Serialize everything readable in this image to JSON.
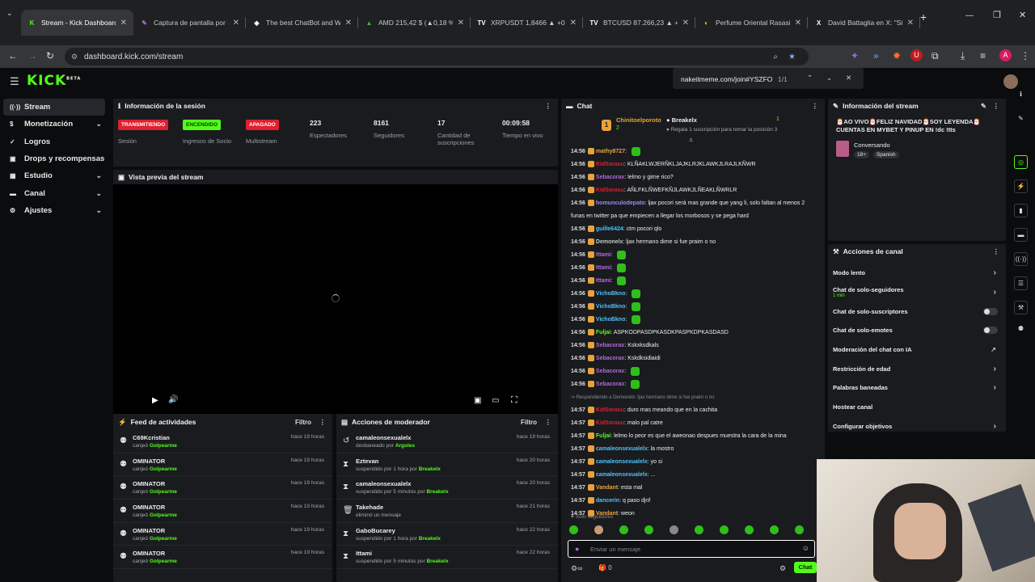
{
  "browser": {
    "tabs": [
      {
        "title": "Stream - Kick Dashboard",
        "fav": "K",
        "favColor": "#53fc18",
        "active": true
      },
      {
        "title": "Captura de pantalla por L",
        "fav": "✎",
        "favColor": "#b06ad9"
      },
      {
        "title": "The best ChatBot and Wi",
        "fav": "◆",
        "favColor": "#ffffff"
      },
      {
        "title": "AMD 215,42 $ (▲0,18 %)",
        "fav": "▲",
        "favColor": "#4caf50"
      },
      {
        "title": "XRPUSDT 1,8466 ▲ +0,7",
        "fav": "TV",
        "favColor": "#ffffff"
      },
      {
        "title": "BTCUSD 87.266,23 ▲ +0,5",
        "fav": "TV",
        "favColor": "#ffffff"
      },
      {
        "title": "Perfume Oriental Rasasi",
        "fav": "◐",
        "favColor": "#f5c542"
      },
      {
        "title": "David Battaglia en X: \"Sit",
        "fav": "X",
        "favColor": "#ffffff"
      }
    ],
    "url": "dashboard.kick.com/stream",
    "popup_url": "nakeitmeme.com/join#YSZFO",
    "popup_count": "1/1"
  },
  "app": {
    "logo": "KICK",
    "logo_tag": "BETA"
  },
  "sidebar": [
    {
      "label": "Stream",
      "icon": "((·))",
      "active": true,
      "chevron": false
    },
    {
      "label": "Monetización",
      "icon": "$",
      "chevron": true
    },
    {
      "label": "Logros",
      "icon": "✓",
      "chevron": false
    },
    {
      "label": "Drops y recompensas",
      "icon": "▣",
      "chevron": false
    },
    {
      "label": "Estudio",
      "icon": "▦",
      "chevron": true
    },
    {
      "label": "Canal",
      "icon": "▬",
      "chevron": true
    },
    {
      "label": "Ajustes",
      "icon": "⚙",
      "chevron": true
    }
  ],
  "session": {
    "title": "Información de la sesión",
    "stats": [
      {
        "badge": "TRANSMITIENDO",
        "badgeBg": "#e0202e",
        "badgeFg": "#ffffff",
        "label": "Sesión"
      },
      {
        "badge": "ENCENDIDO",
        "badgeBg": "#53fc18",
        "badgeFg": "#0b3b00",
        "label": "Ingresos de Socio"
      },
      {
        "badge": "APAGADO",
        "badgeBg": "#e0202e",
        "badgeFg": "#ffffff",
        "label": "Multistream"
      },
      {
        "num": "223",
        "label": "Espectadores"
      },
      {
        "num": "8161",
        "label": "Seguidores"
      },
      {
        "num": "17",
        "label": "Cantidad de suscripciones"
      },
      {
        "num": "00:09:58",
        "label": "Tiempo en vivo"
      }
    ]
  },
  "preview": {
    "title": "Vista previa del stream"
  },
  "feed": {
    "title": "Feed de actividades",
    "filter": "Filtro",
    "items": [
      {
        "name": "C69Kcristian",
        "action": "canjeó",
        "target": "Golpearme",
        "time": "hace 19 horas"
      },
      {
        "name": "OMINATOR",
        "action": "canjeó",
        "target": "Golpearme",
        "time": "hace 19 horas"
      },
      {
        "name": "OMINATOR",
        "action": "canjeó",
        "target": "Golpearme",
        "time": "hace 19 horas"
      },
      {
        "name": "OMINATOR",
        "action": "canjeó",
        "target": "Golpearme",
        "time": "hace 19 horas"
      },
      {
        "name": "OMINATOR",
        "action": "canjeó",
        "target": "Golpearme",
        "time": "hace 19 horas"
      },
      {
        "name": "OMINATOR",
        "action": "canjeó",
        "target": "Golpearme",
        "time": "hace 19 horas"
      }
    ]
  },
  "mod": {
    "title": "Acciones de moderador",
    "filter": "Filtro",
    "items": [
      {
        "icon": "↺",
        "name": "camaleonsexualelx",
        "action": "desbaneado por",
        "target": "Argoles",
        "time": "hace 19 horas"
      },
      {
        "icon": "⧗",
        "name": "Eztevan",
        "action": "suspendido por 1 hora por",
        "target": "Breakelx",
        "time": "hace 20 horas"
      },
      {
        "icon": "⧗",
        "name": "camaleonsexualelx",
        "action": "suspendido por 5 minutos por",
        "target": "Breakelx",
        "time": "hace 20 horas"
      },
      {
        "icon": "🗑",
        "name": "Takehade",
        "action": "eliminó un mensaje",
        "target": "",
        "time": "hace 21 horas"
      },
      {
        "icon": "⧗",
        "name": "GaboBucarey",
        "action": "suspendido por 1 hora por",
        "target": "Breakelx",
        "time": "hace 22 horas"
      },
      {
        "icon": "⧗",
        "name": "Ittami",
        "action": "suspendido por 5 minutos por",
        "target": "Breakelx",
        "time": "hace 22 horas"
      }
    ]
  },
  "chat": {
    "title": "Chat",
    "pinned_user1": "Chinitoelporoto",
    "pinned_user2": "Breakelx",
    "pinned_rank": "1",
    "pinned_rank_small": "2",
    "pinned_note": "Regala 1 suscripción para tomar la posición 3",
    "messages": [
      {
        "time": "14:56",
        "user": "mathy8727",
        "color": "#e9a23b",
        "text": "",
        "emote": true
      },
      {
        "time": "14:56",
        "user": "KidSorasu",
        "color": "#e0202e",
        "text": "KLÑAKLWJERÑKLJAJKLRJKLAWKJLRAJLKÑWR"
      },
      {
        "time": "14:56",
        "user": "Sebacorax",
        "color": "#b06ad9",
        "text": "lelmo y gime rico?"
      },
      {
        "time": "14:56",
        "user": "KidSorasu",
        "color": "#e0202e",
        "text": "AÑLFKLÑWEFKÑJLAWKJLÑEAKLÑWRLR"
      },
      {
        "time": "14:56",
        "user": "homunculodepato",
        "color": "#9b8cf0",
        "text": "ljax pocori será mas grande que yang li, solo faltan al menos 2"
      },
      {
        "time": "",
        "user": "",
        "color": "#eeeeee",
        "text": "funas en twitter pa que empiecen a llegar los morbosos y se pega hard"
      },
      {
        "time": "14:56",
        "user": "guille6424",
        "color": "#4fc3f7",
        "text": "ctm pocori qlo"
      },
      {
        "time": "14:56",
        "user": "Demonelx",
        "color": "#c7c7c7",
        "text": "ljax hermano dime si fue praim o no"
      },
      {
        "time": "14:56",
        "user": "Ittami",
        "color": "#b06ad9",
        "text": "",
        "emote": true
      },
      {
        "time": "14:56",
        "user": "Ittami",
        "color": "#b06ad9",
        "text": "",
        "emote": true
      },
      {
        "time": "14:56",
        "user": "Ittami",
        "color": "#b06ad9",
        "text": "",
        "emote": true
      },
      {
        "time": "14:56",
        "user": "VichoBkno",
        "color": "#4fc3f7",
        "text": "",
        "emote": true
      },
      {
        "time": "14:56",
        "user": "VichoBkno",
        "color": "#4fc3f7",
        "text": "",
        "emote": true
      },
      {
        "time": "14:56",
        "user": "VichoBkno",
        "color": "#4fc3f7",
        "text": "",
        "emote": true
      },
      {
        "time": "14:56",
        "user": "Fuljai",
        "color": "#53fc18",
        "text": "ASPKODPASDPKASDKPASPKDPKASDASD"
      },
      {
        "time": "14:56",
        "user": "Sebacorax",
        "color": "#b06ad9",
        "text": "Kskxksdkals"
      },
      {
        "time": "14:56",
        "user": "Sebacorax",
        "color": "#b06ad9",
        "text": "Kskdksidiaidi"
      },
      {
        "time": "14:56",
        "user": "Sebacorax",
        "color": "#b06ad9",
        "text": "",
        "emote": true
      },
      {
        "time": "14:56",
        "user": "Sebacorax",
        "color": "#b06ad9",
        "text": "",
        "emote": true
      },
      {
        "time": "",
        "user": "",
        "color": "#8a8f96",
        "text": "↪ Respondiendo a Demonelx: ljax hermano dime si fue praim o no",
        "reply": true
      },
      {
        "time": "14:57",
        "user": "KidSorasu",
        "color": "#e0202e",
        "text": "duro mas meando que en la cachita"
      },
      {
        "time": "14:57",
        "user": "KidSorasu",
        "color": "#e0202e",
        "text": "malo pal catre"
      },
      {
        "time": "14:57",
        "user": "Fuljai",
        "color": "#53fc18",
        "text": "lelmo lo peor es que el aweonao despues muestra la cara de la mina"
      },
      {
        "time": "14:57",
        "user": "camaleonsexualelx",
        "color": "#4fc3f7",
        "text": "la mostro"
      },
      {
        "time": "14:57",
        "user": "camaleonsexualelx",
        "color": "#4fc3f7",
        "text": "yo si"
      },
      {
        "time": "14:57",
        "user": "camaleonsexualelx",
        "color": "#4fc3f7",
        "text": "..."
      },
      {
        "time": "14:57",
        "user": "Vandant",
        "color": "#e9a23b",
        "text": "esta mal"
      },
      {
        "time": "14:57",
        "user": "dancerin",
        "color": "#4fc3f7",
        "text": "q paso djnf"
      },
      {
        "time": "14:57",
        "user": "Vandant",
        "color": "#e9a23b",
        "text": "weon"
      }
    ],
    "followers_only": "Solo seguidores",
    "input_placeholder": "Enviar un mensaje",
    "gift_count": "0",
    "send_label": "Chat"
  },
  "stream_info": {
    "title": "Información del stream",
    "stream_title": "🎅AO VIVO🎅FELIZ NAVIDAD🎅SOY LEYENDA🎅 CUENTAS EN MYBET Y PINUP EN !dc !tts",
    "category": "Conversando",
    "tags": [
      "18+",
      "Spanish"
    ]
  },
  "channel_actions": {
    "title": "Acciones de canal",
    "items": [
      {
        "label": "Modo lento",
        "kind": "chevron"
      },
      {
        "label": "Chat de solo-seguidores",
        "sub": "1 min",
        "kind": "chevron"
      },
      {
        "label": "Chat de solo-suscriptores",
        "kind": "toggle"
      },
      {
        "label": "Chat de solo-emotes",
        "kind": "toggle"
      },
      {
        "label": "Moderación del chat con IA",
        "kind": "external"
      },
      {
        "label": "Restricción de edad",
        "kind": "chevron"
      },
      {
        "label": "Palabras baneadas",
        "kind": "chevron"
      },
      {
        "label": "Hostear canal",
        "kind": "none"
      },
      {
        "label": "Configurar objetivos",
        "kind": "chevron"
      }
    ]
  }
}
